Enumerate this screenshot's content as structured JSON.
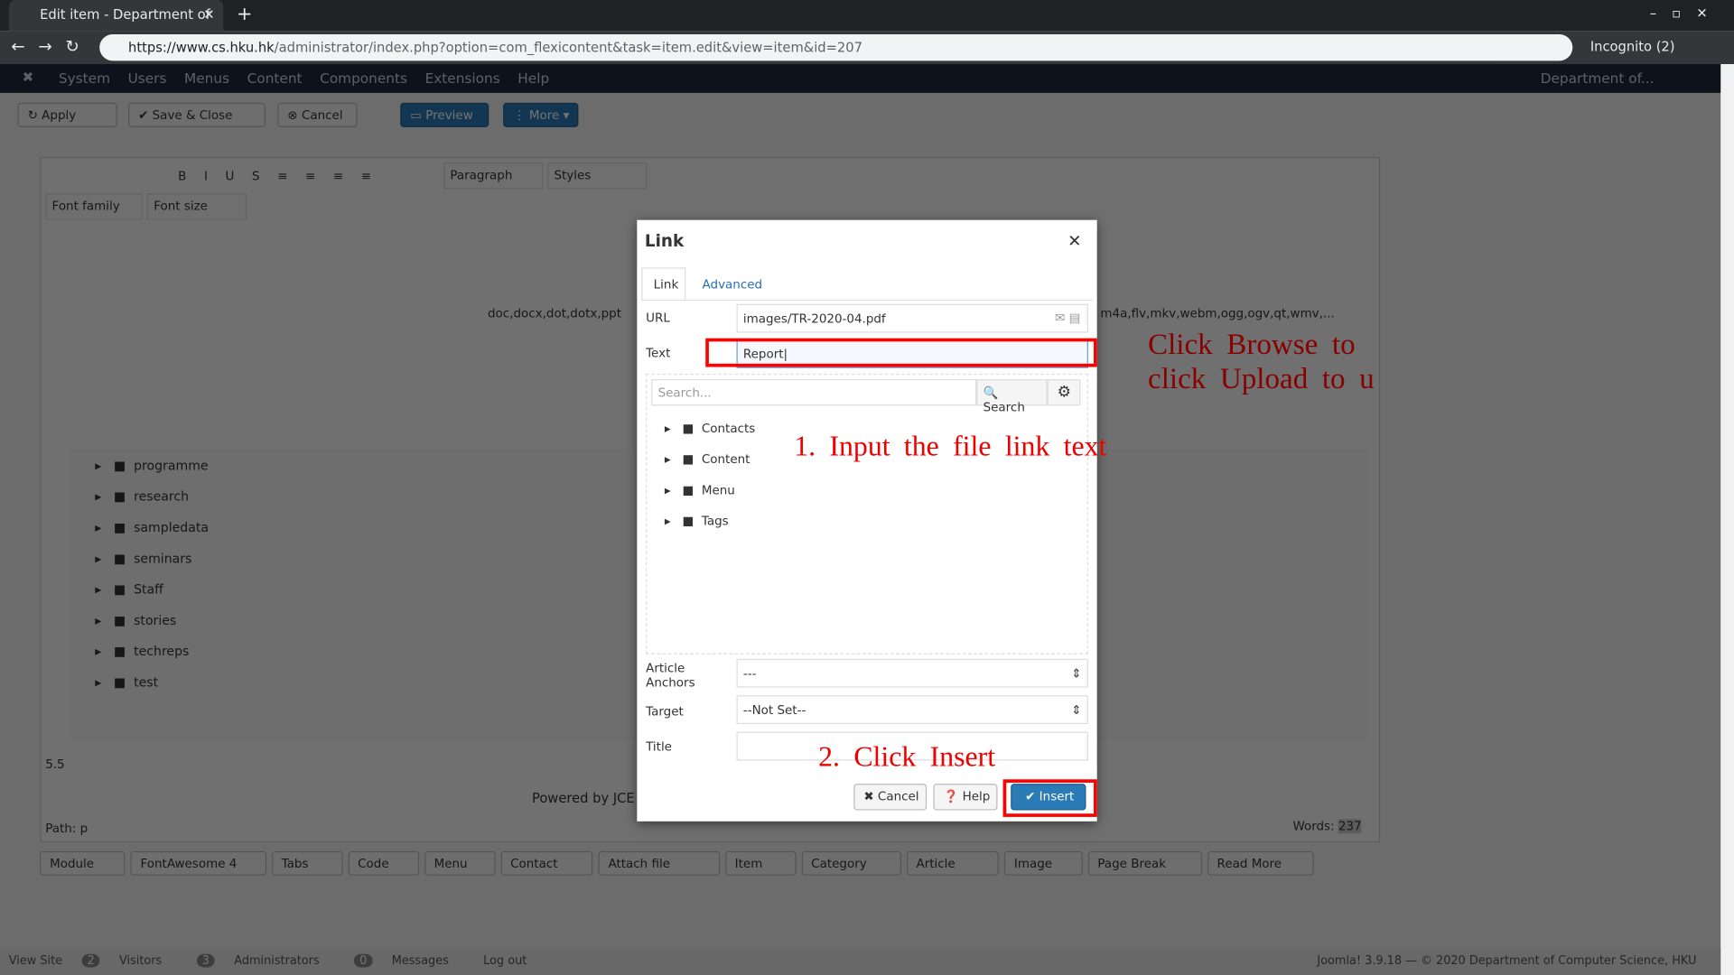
{
  "browser": {
    "tab_title": "Edit item - Department of",
    "url_host": "https://www.cs.hku.hk",
    "url_path": "/administrator/index.php?option=com_flexicontent&task=item.edit&view=item&id=207",
    "incognito": "Incognito (2)"
  },
  "nav": {
    "items": [
      "System",
      "Users",
      "Menus",
      "Content",
      "Components",
      "Extensions",
      "Help"
    ],
    "site": "Department of..."
  },
  "toolbar": {
    "apply": "Apply",
    "save_close": "Save & Close",
    "cancel": "Cancel",
    "preview": "Preview",
    "more": "More"
  },
  "editor": {
    "paragraph": "Paragraph",
    "styles": "Styles",
    "font_family": "Font family",
    "font_size": "Font size",
    "file_types": "doc,docx,dot,dotx,ppt",
    "file_types2": "m4a,flv,mkv,webm,ogg,ogv,qt,wmv,...",
    "folders": [
      "programme",
      "research",
      "sampledata",
      "seminars",
      "Staff",
      "stories",
      "techreps",
      "test"
    ],
    "version": "5.5",
    "powered": "Powered by JCE",
    "path": "Path: p",
    "words_label": "Words:",
    "words": "237"
  },
  "buttons": [
    "Module",
    "FontAwesome 4",
    "Tabs",
    "Code",
    "Menu",
    "Contact",
    "Attach file",
    "Item",
    "Category",
    "Article",
    "Image",
    "Page Break",
    "Read More"
  ],
  "dialog": {
    "title": "Link",
    "tabs": [
      "Link",
      "Advanced"
    ],
    "url_label": "URL",
    "url_value": "images/TR-2020-04.pdf",
    "text_label": "Text",
    "text_value": "Report",
    "search_placeholder": "Search...",
    "search_button": "Search",
    "tree": [
      "Contacts",
      "Content",
      "Menu",
      "Tags"
    ],
    "anchors_label": "Article Anchors",
    "anchors_value": "---",
    "target_label": "Target",
    "target_value": "--Not Set--",
    "title_label": "Title",
    "cancel": "Cancel",
    "help": "Help",
    "insert": "Insert"
  },
  "annotations": {
    "step1": "1. Input the file link text",
    "step2": "2. Click Insert",
    "browse1": "Click Browse to",
    "browse2": "click Upload to u"
  },
  "footer": {
    "view_site": "View Site",
    "visitors_count": "2",
    "visitors": "Visitors",
    "admins_count": "3",
    "admins": "Administrators",
    "messages_count": "0",
    "messages": "Messages",
    "logout": "Log out",
    "copyright": "Joomla! 3.9.18 — © 2020 Department of Computer Science, HKU"
  }
}
